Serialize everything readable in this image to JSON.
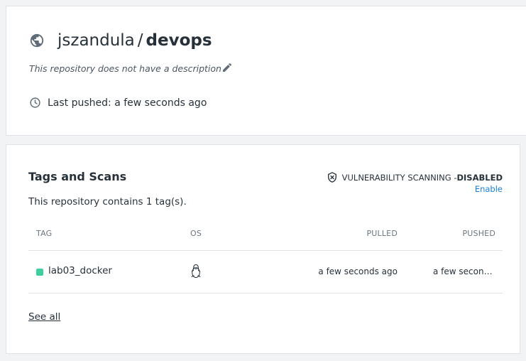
{
  "repo": {
    "namespace": "jszandula",
    "separator": "/",
    "name": "devops",
    "description": "This repository does not have a description",
    "last_pushed": "Last pushed: a few seconds ago",
    "icons": {
      "visibility": "globe-icon",
      "edit": "pencil-icon",
      "time": "clock-icon"
    }
  },
  "tags_section": {
    "title": "Tags and Scans",
    "count_text": "This repository contains 1 tag(s).",
    "vuln_label": "VULNERABILITY SCANNING - ",
    "vuln_status": "DISABLED",
    "enable_link": "Enable",
    "columns": {
      "tag": "TAG",
      "os": "OS",
      "pulled": "PULLED",
      "pushed": "PUSHED"
    },
    "rows": [
      {
        "tag": "lab03_docker",
        "os_icon": "linux-icon",
        "pulled": "a few seconds ago",
        "pushed": "a few seconds ago",
        "status_color": "#3fcf9c"
      }
    ],
    "see_all": "See all"
  },
  "colors": {
    "accent_link": "#1a82d6",
    "text": "#27313a",
    "muted": "#6b7680",
    "border": "#dfe3e8"
  }
}
